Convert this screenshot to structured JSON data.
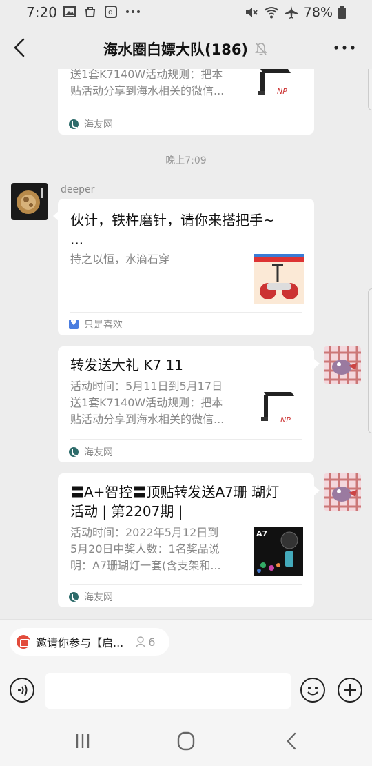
{
  "status_bar": {
    "time": "7:20",
    "battery": "78%",
    "icons": [
      "gallery-icon",
      "shopping-bag-icon",
      "dianping-icon",
      "more-dots-icon",
      "mute-icon",
      "wifi-icon",
      "airplane-icon",
      "battery-icon"
    ]
  },
  "nav": {
    "title": "海水圈白嫖大队(186)",
    "icons": [
      "back-arrow-icon",
      "mute-bell-icon",
      "more-icon"
    ]
  },
  "messages": {
    "card_top": {
      "desc_lines": [
        "送1套K7140W活动规则：把本",
        "贴活动分享到海水相关的微信..."
      ],
      "source": "海友网"
    },
    "timestamp": "晚上7:09",
    "sender_name": "deeper",
    "card_deeper": {
      "title_lines": [
        "伙计，铁杵磨针，请你来搭把手~",
        "..."
      ],
      "desc": "持之以恒，水滴石穿",
      "source": "只是喜欢"
    },
    "card_k7": {
      "title": "转发送大礼 K7 11",
      "desc_lines": [
        "活动时间：5月11日到5月17日",
        "送1套K7140W活动规则：把本",
        "贴活动分享到海水相关的微信..."
      ],
      "source": "海友网"
    },
    "card_a7": {
      "title_lines": [
        "〓A+智控〓顶贴转发送A7珊 瑚灯",
        "活动 | 第2207期 |"
      ],
      "desc_lines": [
        "活动时间：2022年5月12日到",
        "5月20日中奖人数：1名奖品说",
        "明：A7珊瑚灯一套(含支架和..."
      ],
      "source": "海友网"
    }
  },
  "bottom": {
    "invite_label": "邀请你参与【启...",
    "invite_count": "6",
    "input_value": ""
  },
  "colors": {
    "background": "#ededed",
    "bubble": "#ffffff",
    "muted_text": "#888888",
    "source_icon_teal": "#2d6b6a",
    "invite_red": "#e24b3b"
  }
}
